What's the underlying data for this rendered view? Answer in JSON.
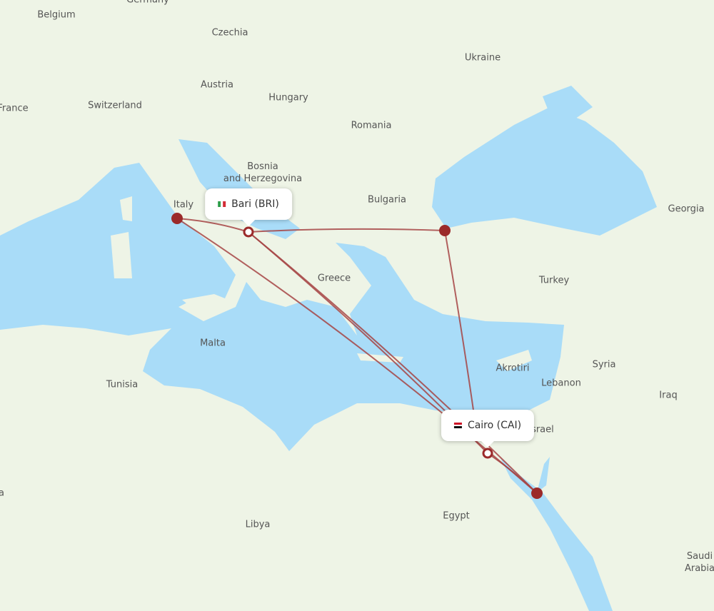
{
  "colors": {
    "land": "#eef4e6",
    "sea": "#a9dcf8",
    "route": "#a64444",
    "airport": "#9b2a2a"
  },
  "labels": [
    {
      "id": "belgium",
      "text": "Belgium"
    },
    {
      "id": "germany",
      "text": "Germany"
    },
    {
      "id": "czechia",
      "text": "Czechia"
    },
    {
      "id": "ukraine",
      "text": "Ukraine"
    },
    {
      "id": "austria",
      "text": "Austria"
    },
    {
      "id": "hungary",
      "text": "Hungary"
    },
    {
      "id": "france",
      "text": "France"
    },
    {
      "id": "switzerland",
      "text": "Switzerland"
    },
    {
      "id": "romania",
      "text": "Romania"
    },
    {
      "id": "bosnia",
      "text": "Bosnia\nand Herzegovina"
    },
    {
      "id": "bulgaria",
      "text": "Bulgaria"
    },
    {
      "id": "georgia",
      "text": "Georgia"
    },
    {
      "id": "italy",
      "text": "Italy"
    },
    {
      "id": "greece",
      "text": "Greece"
    },
    {
      "id": "turkey",
      "text": "Turkey"
    },
    {
      "id": "malta",
      "text": "Malta"
    },
    {
      "id": "akrotiri",
      "text": "Akrotiri"
    },
    {
      "id": "syria",
      "text": "Syria"
    },
    {
      "id": "tunisia",
      "text": "Tunisia"
    },
    {
      "id": "lebanon",
      "text": "Lebanon"
    },
    {
      "id": "iraq",
      "text": "Iraq"
    },
    {
      "id": "israel",
      "text": "Israel"
    },
    {
      "id": "egypt",
      "text": "Egypt"
    },
    {
      "id": "libya",
      "text": "Libya"
    },
    {
      "id": "saudi",
      "text": "Saudi\nArabia"
    },
    {
      "id": "algeria",
      "text": "a"
    }
  ],
  "origin": {
    "label": "Bari (BRI)",
    "flag": "italy-flag"
  },
  "destination": {
    "label": "Cairo (CAI)",
    "flag": "egypt-flag"
  }
}
